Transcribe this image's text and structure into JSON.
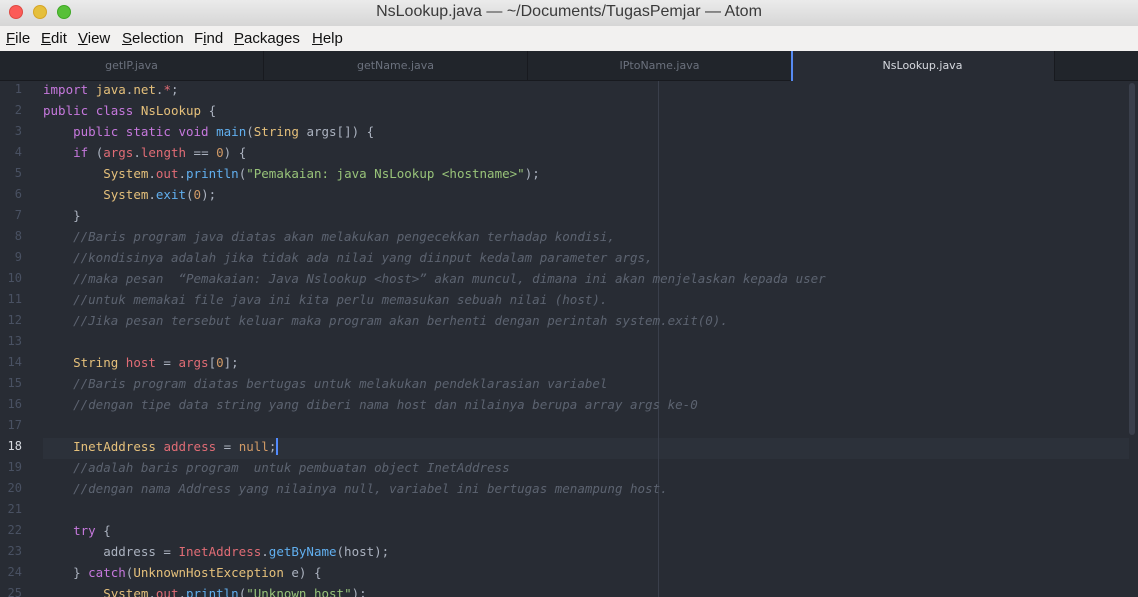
{
  "window": {
    "title": "NsLookup.java — ~/Documents/TugasPemjar — Atom"
  },
  "menu": [
    {
      "acc": "F",
      "rest": "ile"
    },
    {
      "acc": "E",
      "rest": "dit"
    },
    {
      "acc": "V",
      "rest": "iew"
    },
    {
      "acc": "S",
      "rest": "election"
    },
    {
      "pre": "F",
      "acc": "i",
      "rest": "nd"
    },
    {
      "acc": "P",
      "rest": "ackages"
    },
    {
      "acc": "H",
      "rest": "elp"
    }
  ],
  "tabs": [
    "getIP.java",
    "getName.java",
    "IPtoName.java",
    "NsLookup.java"
  ],
  "active_tab": 3,
  "cursor_line": 18,
  "colors": {
    "accent": "#568af2",
    "background": "#282c34",
    "tabbar": "#21252b"
  },
  "lines": [
    [
      [
        "kw",
        "import"
      ],
      [
        "pl",
        " "
      ],
      [
        "cls",
        "java"
      ],
      [
        "pl",
        "."
      ],
      [
        "cls",
        "net"
      ],
      [
        "pl",
        "."
      ],
      [
        "var",
        "*"
      ],
      [
        "pl",
        ";"
      ]
    ],
    [
      [
        "kw",
        "public"
      ],
      [
        "pl",
        " "
      ],
      [
        "kw",
        "class"
      ],
      [
        "pl",
        " "
      ],
      [
        "cls",
        "NsLookup"
      ],
      [
        "pl",
        " {"
      ]
    ],
    [
      [
        "pl",
        "    "
      ],
      [
        "kw",
        "public"
      ],
      [
        "pl",
        " "
      ],
      [
        "kw",
        "static"
      ],
      [
        "pl",
        " "
      ],
      [
        "kw",
        "void"
      ],
      [
        "pl",
        " "
      ],
      [
        "fn",
        "main"
      ],
      [
        "pl",
        "("
      ],
      [
        "cls",
        "String"
      ],
      [
        "pl",
        " args[]) {"
      ]
    ],
    [
      [
        "pl",
        "    "
      ],
      [
        "kw",
        "if"
      ],
      [
        "pl",
        " ("
      ],
      [
        "var",
        "args"
      ],
      [
        "pl",
        "."
      ],
      [
        "var",
        "length"
      ],
      [
        "pl",
        " == "
      ],
      [
        "num",
        "0"
      ],
      [
        "pl",
        ") {"
      ]
    ],
    [
      [
        "pl",
        "        "
      ],
      [
        "cls",
        "System"
      ],
      [
        "pl",
        "."
      ],
      [
        "var",
        "out"
      ],
      [
        "pl",
        "."
      ],
      [
        "fn",
        "println"
      ],
      [
        "pl",
        "("
      ],
      [
        "str",
        "\"Pemakaian: java NsLookup <hostname>\""
      ],
      [
        "pl",
        ");"
      ]
    ],
    [
      [
        "pl",
        "        "
      ],
      [
        "cls",
        "System"
      ],
      [
        "pl",
        "."
      ],
      [
        "fn",
        "exit"
      ],
      [
        "pl",
        "("
      ],
      [
        "num",
        "0"
      ],
      [
        "pl",
        ");"
      ]
    ],
    [
      [
        "pl",
        "    }"
      ]
    ],
    [
      [
        "pl",
        "    "
      ],
      [
        "cmt",
        "//Baris program java diatas akan melakukan pengecekkan terhadap kondisi,"
      ]
    ],
    [
      [
        "pl",
        "    "
      ],
      [
        "cmt",
        "//kondisinya adalah jika tidak ada nilai yang diinput kedalam parameter args,"
      ]
    ],
    [
      [
        "pl",
        "    "
      ],
      [
        "cmt",
        "//maka pesan  “Pemakaian: Java Nslookup <host>” akan muncul, dimana ini akan menjelaskan kepada user"
      ]
    ],
    [
      [
        "pl",
        "    "
      ],
      [
        "cmt",
        "//untuk memakai file java ini kita perlu memasukan sebuah nilai (host)."
      ]
    ],
    [
      [
        "pl",
        "    "
      ],
      [
        "cmt",
        "//Jika pesan tersebut keluar maka program akan berhenti dengan perintah system.exit(0)."
      ]
    ],
    [],
    [
      [
        "pl",
        "    "
      ],
      [
        "cls",
        "String"
      ],
      [
        "pl",
        " "
      ],
      [
        "var",
        "host"
      ],
      [
        "pl",
        " = "
      ],
      [
        "var",
        "args"
      ],
      [
        "pl",
        "["
      ],
      [
        "num",
        "0"
      ],
      [
        "pl",
        "];"
      ]
    ],
    [
      [
        "pl",
        "    "
      ],
      [
        "cmt",
        "//Baris program diatas bertugas untuk melakukan pendeklarasian variabel"
      ]
    ],
    [
      [
        "pl",
        "    "
      ],
      [
        "cmt",
        "//dengan tipe data string yang diberi nama host dan nilainya berupa array args ke-0"
      ]
    ],
    [],
    [
      [
        "pl",
        "    "
      ],
      [
        "cls",
        "InetAddress"
      ],
      [
        "pl",
        " "
      ],
      [
        "var",
        "address"
      ],
      [
        "pl",
        " = "
      ],
      [
        "num",
        "null"
      ],
      [
        "pl",
        ";"
      ]
    ],
    [
      [
        "pl",
        "    "
      ],
      [
        "cmt",
        "//adalah baris program  untuk pembuatan object InetAddress"
      ]
    ],
    [
      [
        "pl",
        "    "
      ],
      [
        "cmt",
        "//dengan nama Address yang nilainya null, variabel ini bertugas menampung host."
      ]
    ],
    [],
    [
      [
        "pl",
        "    "
      ],
      [
        "kw",
        "try"
      ],
      [
        "pl",
        " {"
      ]
    ],
    [
      [
        "pl",
        "        address = "
      ],
      [
        "var",
        "InetAddress"
      ],
      [
        "pl",
        "."
      ],
      [
        "fn",
        "getByName"
      ],
      [
        "pl",
        "(host);"
      ]
    ],
    [
      [
        "pl",
        "    } "
      ],
      [
        "kw",
        "catch"
      ],
      [
        "pl",
        "("
      ],
      [
        "cls",
        "UnknownHostException"
      ],
      [
        "pl",
        " e) {"
      ]
    ],
    [
      [
        "pl",
        "        "
      ],
      [
        "cls",
        "System"
      ],
      [
        "pl",
        "."
      ],
      [
        "var",
        "out"
      ],
      [
        "pl",
        "."
      ],
      [
        "fn",
        "println"
      ],
      [
        "pl",
        "("
      ],
      [
        "str",
        "\"Unknown host\""
      ],
      [
        "pl",
        ");"
      ]
    ]
  ]
}
